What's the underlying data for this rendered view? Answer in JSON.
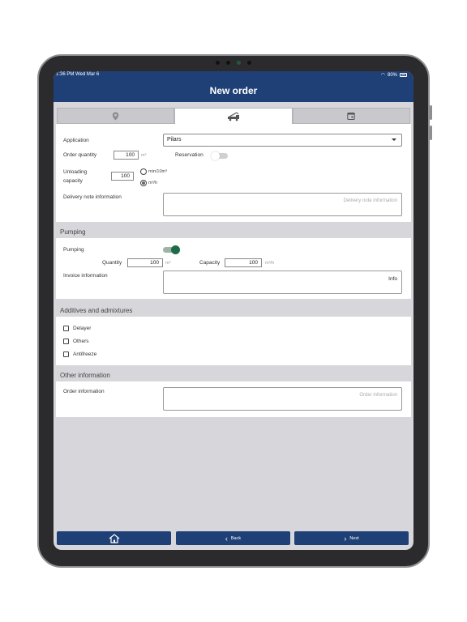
{
  "status": {
    "time": "1:36 PM",
    "date": "Wed Mar 6",
    "battery": "80%"
  },
  "nav": {
    "title": "New order"
  },
  "tabs": [
    {
      "icon": "location-pin-icon",
      "active": false
    },
    {
      "icon": "truck-pump-icon",
      "active": true
    },
    {
      "icon": "calendar-icon",
      "active": false
    }
  ],
  "order": {
    "application_label": "Application",
    "application_value": "Pilars",
    "quantity_label": "Order quantity",
    "quantity_value": "100",
    "quantity_unit": "m³",
    "reservation_label": "Reservation",
    "reservation_on": false,
    "unloading_label_1": "Unloading",
    "unloading_label_2": "capacity",
    "unloading_value": "100",
    "unloading_option_1": "min/10m³",
    "unloading_option_2": "m³/h",
    "unloading_selected": "m³/h",
    "delivery_label": "Delivery note information",
    "delivery_placeholder": "Delivery note information"
  },
  "pumping": {
    "header": "Pumping",
    "pumping_label": "Pumping",
    "pumping_on": true,
    "quantity_label": "Quantity",
    "quantity_value": "100",
    "quantity_unit": "m³",
    "capacity_label": "Capacity",
    "capacity_value": "100",
    "capacity_unit": "m³/h",
    "invoice_label": "Invoice information",
    "invoice_value": "Info"
  },
  "additives": {
    "header": "Additives and admixtures",
    "items": [
      {
        "label": "Delayer",
        "checked": false
      },
      {
        "label": "Others",
        "checked": false
      },
      {
        "label": "Antifreeze",
        "checked": false
      }
    ]
  },
  "other": {
    "header": "Other information",
    "order_info_label": "Order information",
    "order_info_placeholder": "Order information"
  },
  "footer": {
    "home_icon": "home-icon",
    "back_label": "Back",
    "next_label": "Next"
  },
  "colors": {
    "primary": "#1f4077",
    "toggle_on": "#1f6b47",
    "background": "#d7d6db"
  }
}
